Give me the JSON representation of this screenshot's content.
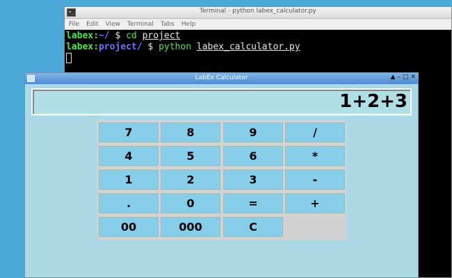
{
  "terminal": {
    "title": "Terminal - python labex_calculator.py",
    "icon": "terminal-icon",
    "menu": [
      "File",
      "Edit",
      "View",
      "Terminal",
      "Tabs",
      "Help"
    ],
    "lines": [
      {
        "user": "labex",
        "sep": ":",
        "path": "~/",
        "prompt": " $ ",
        "cmd": "cd",
        "arg": "project"
      },
      {
        "user": "labex",
        "sep": ":",
        "path": "project/",
        "prompt": " $ ",
        "cmd": "python",
        "arg": "labex_calculator.py"
      }
    ]
  },
  "calculator": {
    "title": "LabEx Calculator",
    "display": "1+2+3",
    "controls": [
      "▲",
      "–",
      "□",
      "✕"
    ],
    "keys": [
      [
        "7",
        "8",
        "9",
        "/"
      ],
      [
        "4",
        "5",
        "6",
        "*"
      ],
      [
        "1",
        "2",
        "3",
        "-"
      ],
      [
        ".",
        "0",
        "=",
        "+"
      ],
      [
        "00",
        "000",
        "C"
      ]
    ]
  }
}
